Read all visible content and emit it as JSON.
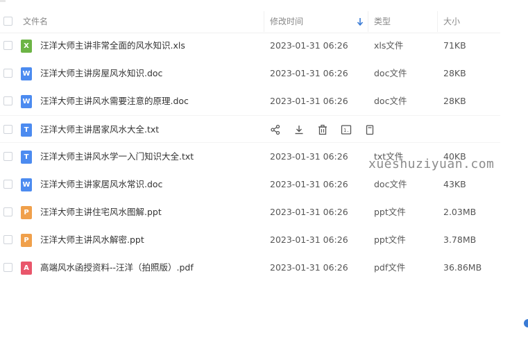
{
  "header": {
    "name_label": "文件名",
    "modified_label": "修改时间",
    "type_label": "类型",
    "size_label": "大小"
  },
  "files": [
    {
      "name": "汪洋大师主讲非常全面的风水知识.xls",
      "date": "2023-01-31 06:26",
      "type": "xls文件",
      "size": "71KB",
      "icon": "xls-file-icon",
      "icon_color": "#6cb445",
      "icon_char": "X"
    },
    {
      "name": "汪洋大师主讲房屋风水知识.doc",
      "date": "2023-01-31 06:26",
      "type": "doc文件",
      "size": "28KB",
      "icon": "doc-file-icon",
      "icon_color": "#4c8bf0",
      "icon_char": "W"
    },
    {
      "name": "汪洋大师主讲风水需要注意的原理.doc",
      "date": "2023-01-31 06:26",
      "type": "doc文件",
      "size": "28KB",
      "icon": "doc-file-icon",
      "icon_color": "#4c8bf0",
      "icon_char": "W"
    },
    {
      "name": "汪洋大师主讲居家风水大全.txt",
      "date": "",
      "type": "",
      "size": "",
      "icon": "txt-file-icon",
      "icon_color": "#4c8bf0",
      "icon_char": "T"
    },
    {
      "name": "汪洋大师主讲风水学一入门知识大全.txt",
      "date": "2023-01-31 06:26",
      "type": "txt文件",
      "size": "40KB",
      "icon": "txt-file-icon",
      "icon_color": "#4c8bf0",
      "icon_char": "T"
    },
    {
      "name": "汪洋大师主讲家居风水常识.doc",
      "date": "2023-01-31 06:26",
      "type": "doc文件",
      "size": "43KB",
      "icon": "doc-file-icon",
      "icon_color": "#4c8bf0",
      "icon_char": "W"
    },
    {
      "name": "汪洋大师主讲住宅风水图解.ppt",
      "date": "2023-01-31 06:26",
      "type": "ppt文件",
      "size": "2.03MB",
      "icon": "ppt-file-icon",
      "icon_color": "#f0a04b",
      "icon_char": "P"
    },
    {
      "name": "汪洋大师主讲风水解密.ppt",
      "date": "2023-01-31 06:26",
      "type": "ppt文件",
      "size": "3.78MB",
      "icon": "ppt-file-icon",
      "icon_color": "#f0a04b",
      "icon_char": "P"
    },
    {
      "name": "高端风水函授资料--汪洋（拍照版）.pdf",
      "date": "2023-01-31 06:26",
      "type": "pdf文件",
      "size": "36.86MB",
      "icon": "pdf-file-icon",
      "icon_color": "#e9566b",
      "icon_char": "A"
    }
  ],
  "hover_actions": [
    "share-icon",
    "download-icon",
    "delete-icon",
    "terminal-icon",
    "copy-icon"
  ],
  "watermark": "xueshuziyuan.com"
}
